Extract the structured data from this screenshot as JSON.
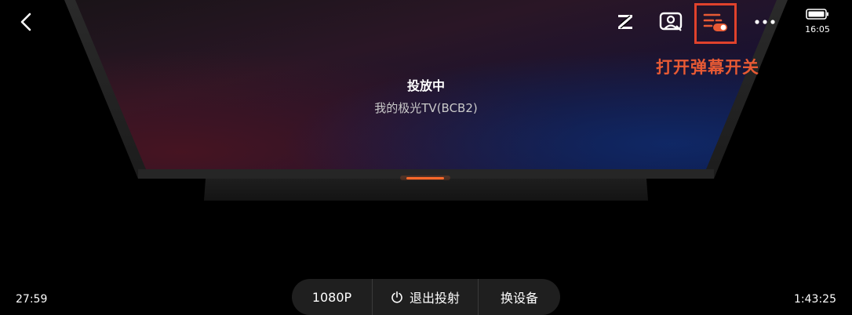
{
  "top_bar": {
    "back_icon": "chevron-left-icon",
    "icons": [
      "z-logo-icon",
      "scene-icon",
      "danmaku-toggle-icon",
      "more-icon"
    ],
    "status_time": "16:05"
  },
  "annotation": {
    "label": "打开弹幕开关",
    "color": "#e85a34"
  },
  "cast": {
    "title": "投放中",
    "device_name": "我的极光TV(BCB2)"
  },
  "playback": {
    "elapsed": "27:59",
    "total": "1:43:25"
  },
  "controls": {
    "resolution": "1080P",
    "exit_label": "退出投射",
    "switch_label": "换设备"
  },
  "colors": {
    "accent": "#e85a34",
    "highlight_border": "#e0422c",
    "tv_glow": "#ff6a2a"
  }
}
